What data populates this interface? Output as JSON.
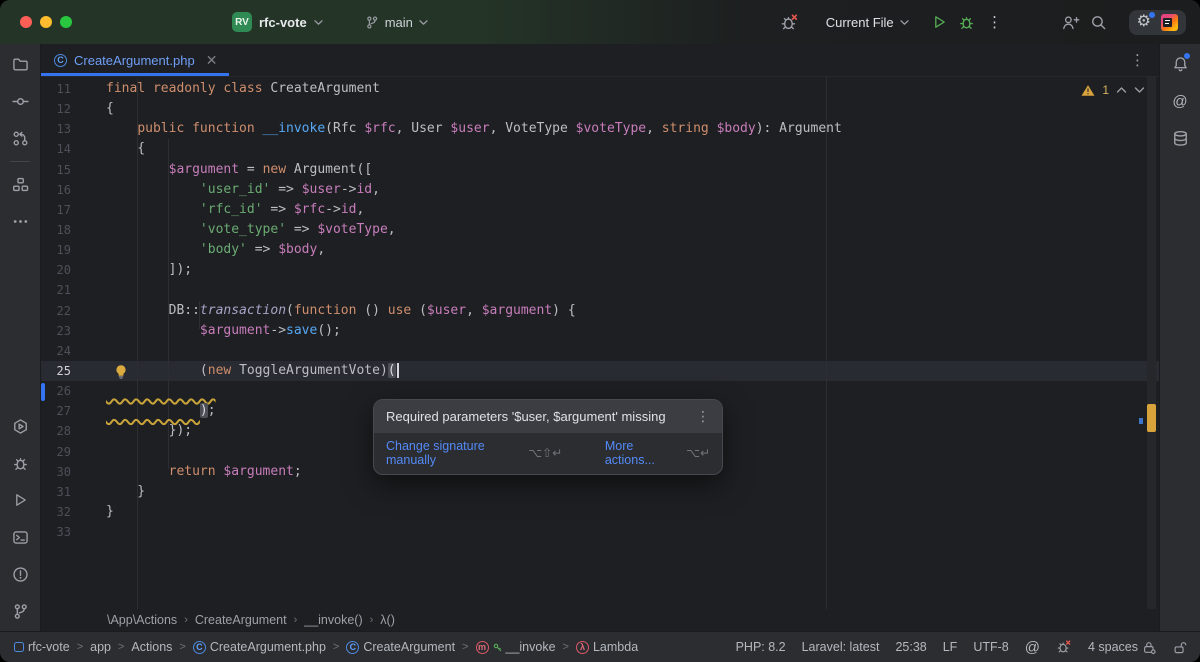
{
  "icons": {
    "class_letter": "C"
  },
  "titlebar": {
    "project_initials": "RV",
    "project_name": "rfc-vote",
    "branch": "main",
    "run_config": "Current File"
  },
  "editor_tabs": [
    {
      "label": "CreateArgument.php"
    }
  ],
  "editor": {
    "caret_line": 25,
    "inspection": {
      "warning_count": "1"
    },
    "lines": [
      {
        "n": 11,
        "seg": [
          [
            "k",
            "final readonly class "
          ],
          [
            "p",
            "CreateArgument"
          ]
        ]
      },
      {
        "n": 12,
        "seg": [
          [
            "p",
            "{"
          ]
        ]
      },
      {
        "n": 13,
        "seg": [
          [
            "p",
            "    "
          ],
          [
            "k",
            "public function "
          ],
          [
            "f",
            "__invoke"
          ],
          [
            "p",
            "(Rfc "
          ],
          [
            "v",
            "$rfc"
          ],
          [
            "p",
            ", User "
          ],
          [
            "v",
            "$user"
          ],
          [
            "p",
            ", VoteType "
          ],
          [
            "v",
            "$voteType"
          ],
          [
            "p",
            ", "
          ],
          [
            "k",
            "string "
          ],
          [
            "v",
            "$body"
          ],
          [
            "p",
            "): Argument"
          ]
        ]
      },
      {
        "n": 14,
        "seg": [
          [
            "p",
            "    {"
          ]
        ]
      },
      {
        "n": 15,
        "seg": [
          [
            "p",
            "        "
          ],
          [
            "v",
            "$argument"
          ],
          [
            "p",
            " = "
          ],
          [
            "k",
            "new "
          ],
          [
            "p",
            "Argument(["
          ]
        ]
      },
      {
        "n": 16,
        "seg": [
          [
            "p",
            "            "
          ],
          [
            "s",
            "'user_id'"
          ],
          [
            "p",
            " => "
          ],
          [
            "v",
            "$user"
          ],
          [
            "p",
            "->"
          ],
          [
            "v",
            "id"
          ],
          [
            "p",
            ","
          ]
        ]
      },
      {
        "n": 17,
        "seg": [
          [
            "p",
            "            "
          ],
          [
            "s",
            "'rfc_id'"
          ],
          [
            "p",
            " => "
          ],
          [
            "v",
            "$rfc"
          ],
          [
            "p",
            "->"
          ],
          [
            "v",
            "id"
          ],
          [
            "p",
            ","
          ]
        ]
      },
      {
        "n": 18,
        "seg": [
          [
            "p",
            "            "
          ],
          [
            "s",
            "'vote_type'"
          ],
          [
            "p",
            " => "
          ],
          [
            "v",
            "$voteType"
          ],
          [
            "p",
            ","
          ]
        ]
      },
      {
        "n": 19,
        "seg": [
          [
            "p",
            "            "
          ],
          [
            "s",
            "'body'"
          ],
          [
            "p",
            " => "
          ],
          [
            "v",
            "$body"
          ],
          [
            "p",
            ","
          ]
        ]
      },
      {
        "n": 20,
        "seg": [
          [
            "p",
            "        ]);"
          ]
        ]
      },
      {
        "n": 21,
        "seg": []
      },
      {
        "n": 22,
        "seg": [
          [
            "p",
            "        DB::"
          ],
          [
            "m",
            "transaction"
          ],
          [
            "p",
            "("
          ],
          [
            "k",
            "function"
          ],
          [
            "p",
            " () "
          ],
          [
            "k",
            "use"
          ],
          [
            "p",
            " ("
          ],
          [
            "v",
            "$user"
          ],
          [
            "p",
            ", "
          ],
          [
            "v",
            "$argument"
          ],
          [
            "p",
            ") {"
          ]
        ]
      },
      {
        "n": 23,
        "seg": [
          [
            "p",
            "            "
          ],
          [
            "v",
            "$argument"
          ],
          [
            "p",
            "->"
          ],
          [
            "f",
            "save"
          ],
          [
            "p",
            "();"
          ]
        ]
      },
      {
        "n": 24,
        "seg": []
      },
      {
        "n": 25,
        "bulb": true,
        "seg": [
          [
            "p",
            "            ("
          ],
          [
            "k",
            "new "
          ],
          [
            "p",
            "ToggleArgumentVote)"
          ],
          [
            "h",
            "("
          ],
          [
            "caret",
            ""
          ]
        ]
      },
      {
        "n": 26,
        "seg": [
          [
            "q",
            "              "
          ]
        ]
      },
      {
        "n": 27,
        "seg": [
          [
            "q",
            "            "
          ],
          [
            "h",
            ")"
          ],
          [
            "p",
            ";"
          ]
        ]
      },
      {
        "n": 28,
        "seg": [
          [
            "p",
            "        });"
          ]
        ]
      },
      {
        "n": 29,
        "seg": []
      },
      {
        "n": 30,
        "seg": [
          [
            "p",
            "        "
          ],
          [
            "k",
            "return "
          ],
          [
            "v",
            "$argument"
          ],
          [
            "p",
            ";"
          ]
        ]
      },
      {
        "n": 31,
        "seg": [
          [
            "p",
            "    }"
          ]
        ]
      },
      {
        "n": 32,
        "seg": [
          [
            "p",
            "}"
          ]
        ]
      },
      {
        "n": 33,
        "seg": []
      }
    ]
  },
  "tooltip": {
    "message": "Required parameters '$user, $argument' missing",
    "actions": [
      {
        "label": "Change signature manually",
        "shortcut": "⌥⇧↵"
      },
      {
        "label": "More actions...",
        "shortcut": "⌥↵"
      }
    ]
  },
  "editor_breadcrumbs": [
    "\\App\\Actions",
    "CreateArgument",
    "__invoke()",
    "λ()"
  ],
  "statusbar": {
    "path": [
      {
        "icon": "module",
        "label": "rfc-vote"
      },
      {
        "label": "app"
      },
      {
        "label": "Actions"
      },
      {
        "icon": "class",
        "letter": "C",
        "label": "CreateArgument.php"
      },
      {
        "icon": "class",
        "letter": "C",
        "label": "CreateArgument"
      },
      {
        "icon": "method",
        "letter": "m",
        "key": true,
        "label": "__invoke"
      },
      {
        "icon": "lambda",
        "letter": "λ",
        "label": "Lambda"
      }
    ],
    "php_version": "PHP: 8.2",
    "framework": "Laravel: latest",
    "caret_position": "25:38",
    "line_separator": "LF",
    "encoding": "UTF-8",
    "indent": "4 spaces"
  }
}
